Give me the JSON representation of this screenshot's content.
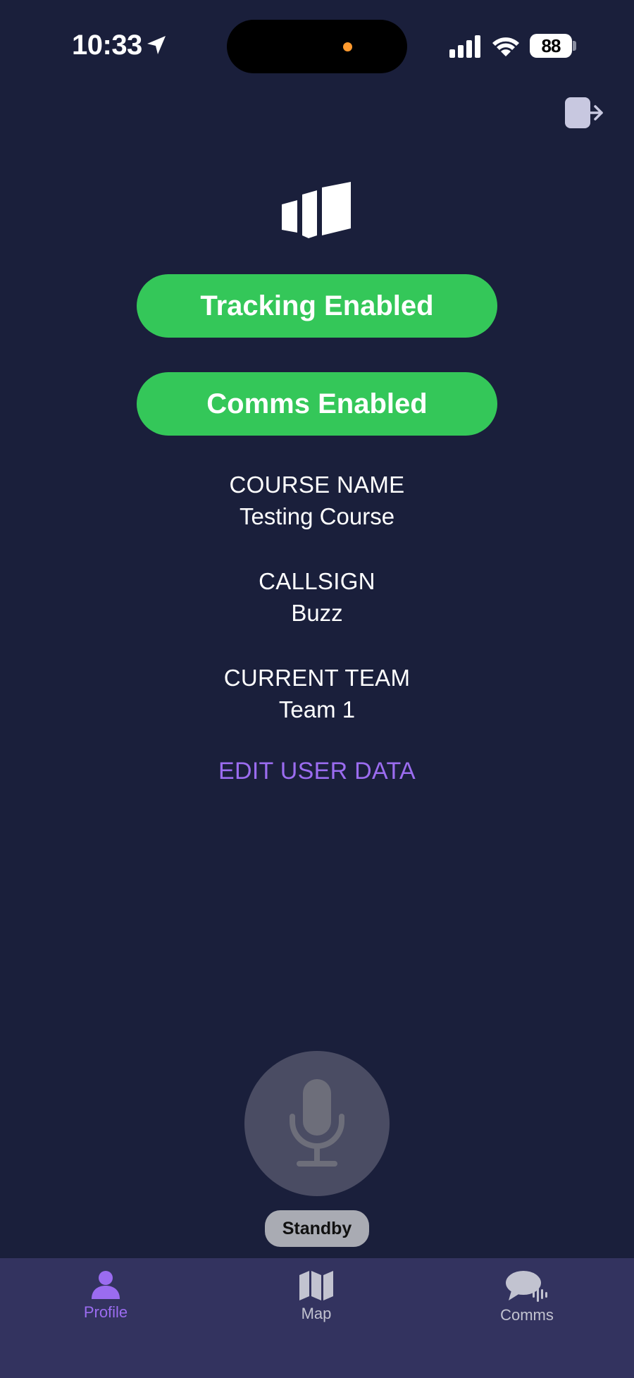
{
  "status_bar": {
    "time": "10:33",
    "battery": "88",
    "icons": [
      "location-arrow-icon",
      "cellular-signal-icon",
      "wifi-icon",
      "battery-icon"
    ]
  },
  "header": {
    "logout_icon": "logout-icon",
    "logo_icon": "bar-logo-icon"
  },
  "toggles": {
    "tracking_label": "Tracking Enabled",
    "comms_label": "Comms Enabled"
  },
  "info": {
    "course_label": "COURSE NAME",
    "course_value": "Testing Course",
    "callsign_label": "CALLSIGN",
    "callsign_value": "Buzz",
    "team_label": "CURRENT TEAM",
    "team_value": "Team 1"
  },
  "edit_link": "EDIT USER DATA",
  "mic": {
    "icon": "microphone-icon",
    "status": "Standby"
  },
  "tabs": [
    {
      "label": "Profile",
      "icon": "person-icon",
      "active": true
    },
    {
      "label": "Map",
      "icon": "map-icon",
      "active": false
    },
    {
      "label": "Comms",
      "icon": "chat-bubbles-icon",
      "active": false
    }
  ],
  "colors": {
    "background": "#1a1f3b",
    "toggle_on": "#34c759",
    "accent": "#9b6cf0",
    "tab_bar": "#33335f"
  }
}
